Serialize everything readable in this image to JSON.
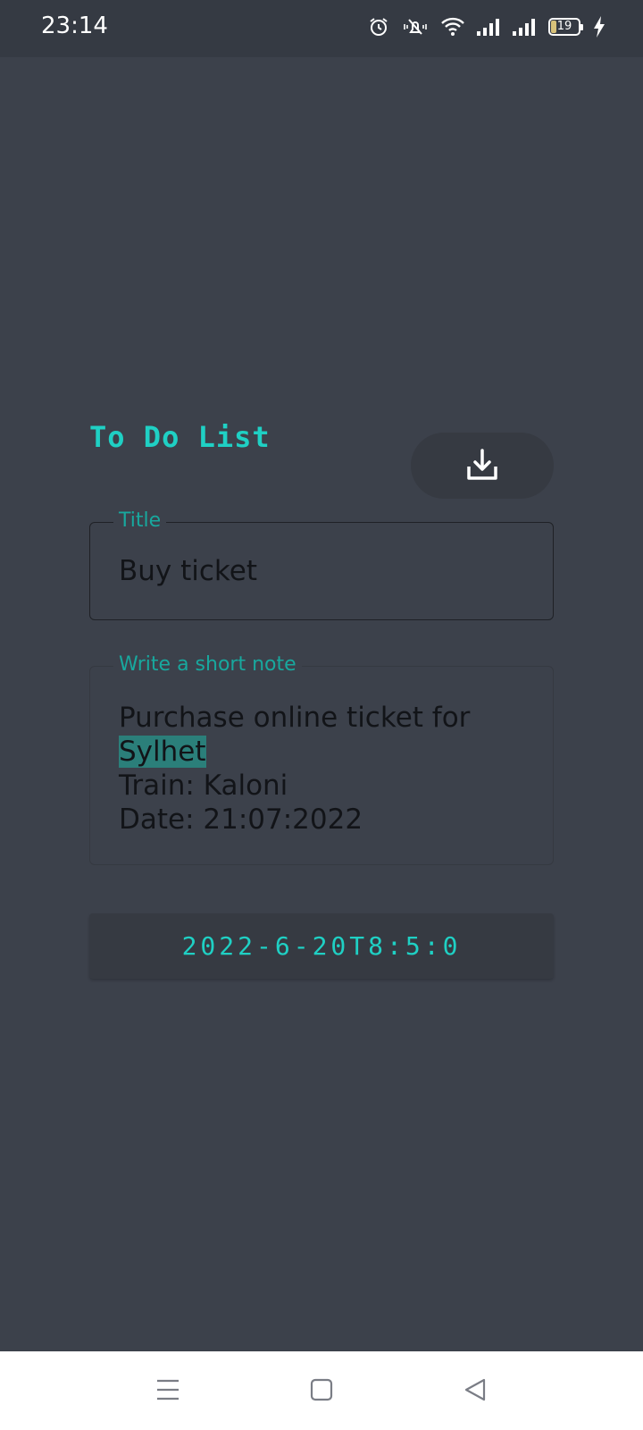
{
  "status_bar": {
    "time": "23:14",
    "battery_level": "19",
    "icons": [
      "alarm-icon",
      "mute-vibrate-icon",
      "wifi-icon",
      "signal-icon",
      "signal-icon",
      "battery-icon",
      "charging-icon"
    ]
  },
  "app": {
    "title": "To Do List",
    "save_icon": "download-icon"
  },
  "form": {
    "title_label": "Title",
    "title_value": "Buy ticket",
    "note_label": "Write a short note",
    "note_line1": "Purchase online ticket for",
    "note_line2": "Sylhet",
    "note_line3": "Train: Kaloni",
    "note_line4": "Date: 21:07:2022",
    "date_value": "2022-6-20T8:5:0"
  },
  "nav_bar": {
    "buttons": [
      "menu-icon",
      "home-icon",
      "back-icon"
    ]
  },
  "colors": {
    "background": "#3c414b",
    "accent": "#1fd0c4",
    "label": "#18a89e",
    "text": "#121418",
    "highlight": "#2b7f7a"
  }
}
